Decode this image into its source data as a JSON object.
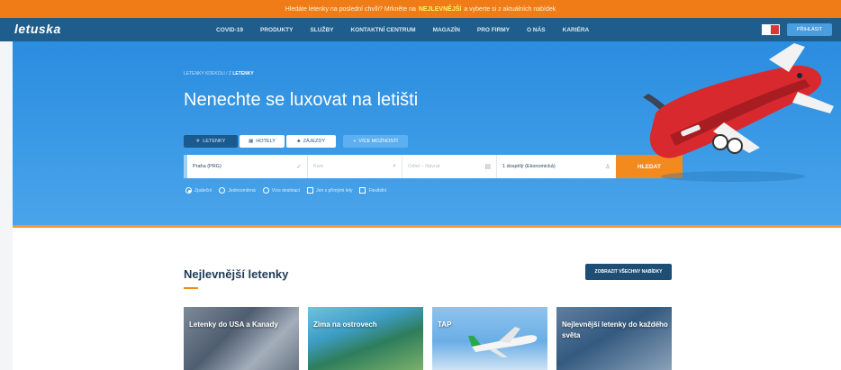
{
  "promo": {
    "text_before": "Hledáte letenky na poslední chvíli? Mrkněte na",
    "highlight": "NEJLEVNĚJŠÍ",
    "text_after": "a vyberte si z aktuálních nabídek"
  },
  "nav": {
    "logo": "letuska",
    "items": [
      "COVID-19",
      "PRODUKTY",
      "SLUŽBY",
      "KONTAKTNÍ CENTRUM",
      "MAGAZÍN",
      "PRO FIRMY",
      "O NÁS",
      "KARIÉRA"
    ],
    "login": "PŘIHLÁSIT"
  },
  "hero": {
    "breadcrumb_prefix": "LETENKY KDEKOLI / Z ",
    "breadcrumb_current": "LETENKY",
    "title": "Nenechte se luxovat na letišti",
    "trip_types": [
      "LETENKY",
      "HOTELY",
      "ZÁJEZDY"
    ],
    "extra_button": "VÍCE MOŽNOSTÍ",
    "search": {
      "from": "Praha (PRG)",
      "to_placeholder": "Kam",
      "dates_placeholder": "Odlet – Návrat",
      "passengers": "1 dospělý (Ekonomická)",
      "submit": "HLEDAT"
    },
    "options": [
      "Zpáteční",
      "Jednosměrná",
      "Více destinací",
      "Jen s přímými lety",
      "Flexibilní"
    ]
  },
  "section": {
    "title": "Nejlevnější letenky",
    "all_button": "ZOBRAZIT VŠECHNY NABÍDKY"
  },
  "cards": [
    {
      "label": "Letenky do USA a Kanady"
    },
    {
      "label": "Zima na ostrovech"
    },
    {
      "label": "TAP"
    },
    {
      "label": "Nejlevnější letenky do každého světa"
    }
  ]
}
